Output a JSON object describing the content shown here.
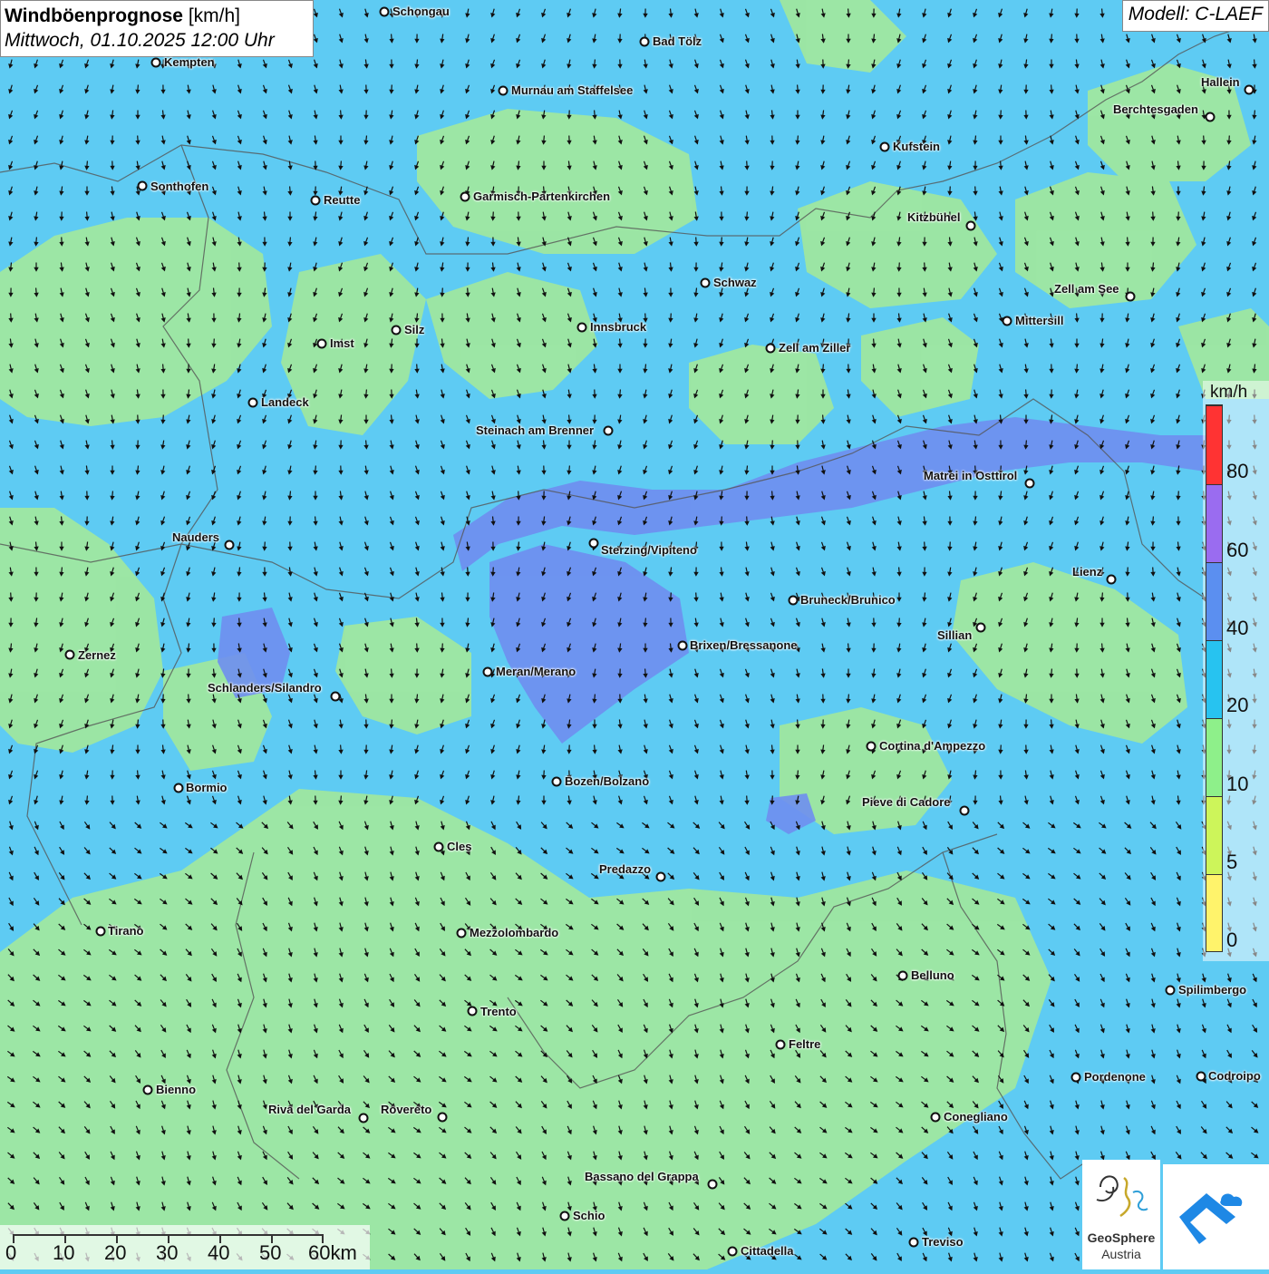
{
  "title": {
    "main": "Windböenprognose",
    "unit": "[km/h]",
    "datetime": "Mittwoch, 01.10.2025 12:00 Uhr"
  },
  "model": "Modell: C-LAEF",
  "legend": {
    "unit": "km/h",
    "labels": [
      "80",
      "60",
      "40",
      "20",
      "10",
      "5",
      "0"
    ],
    "colors": [
      "#ff3333",
      "#9a6cf0",
      "#5b8ff0",
      "#27c3f0",
      "#8ef08a",
      "#cdf55a",
      "#fff36b"
    ]
  },
  "cities": [
    {
      "name": "Schongau",
      "id": "schongau"
    },
    {
      "name": "Bad Tölz",
      "id": "bad-toelz"
    },
    {
      "name": "Kempten",
      "id": "kempten"
    },
    {
      "name": "Murnau am Staffelsee",
      "id": "murnau"
    },
    {
      "name": "Hallein",
      "id": "hallein"
    },
    {
      "name": "Berchtesgaden",
      "id": "berchtesgaden"
    },
    {
      "name": "Kufstein",
      "id": "kufstein"
    },
    {
      "name": "Sonthofen",
      "id": "sonthofen"
    },
    {
      "name": "Reutte",
      "id": "reutte"
    },
    {
      "name": "Garmisch-Partenkirchen",
      "id": "garmisch"
    },
    {
      "name": "Kitzbühel",
      "id": "kitzbuehel"
    },
    {
      "name": "Schwaz",
      "id": "schwaz"
    },
    {
      "name": "Zell am See",
      "id": "zell-am-see"
    },
    {
      "name": "Mittersill",
      "id": "mittersill"
    },
    {
      "name": "Innsbruck",
      "id": "innsbruck"
    },
    {
      "name": "Silz",
      "id": "silz"
    },
    {
      "name": "Imst",
      "id": "imst"
    },
    {
      "name": "Zell am Ziller",
      "id": "zell-am-ziller"
    },
    {
      "name": "Landeck",
      "id": "landeck"
    },
    {
      "name": "Steinach am Brenner",
      "id": "steinach"
    },
    {
      "name": "Matrei in Osttirol",
      "id": "matrei"
    },
    {
      "name": "Nauders",
      "id": "nauders"
    },
    {
      "name": "Sterzing/Vipiteno",
      "id": "sterzing"
    },
    {
      "name": "Lienz",
      "id": "lienz"
    },
    {
      "name": "Bruneck/Brunico",
      "id": "bruneck"
    },
    {
      "name": "Sillian",
      "id": "sillian"
    },
    {
      "name": "Brixen/Bressanone",
      "id": "brixen"
    },
    {
      "name": "Zernez",
      "id": "zernez"
    },
    {
      "name": "Meran/Merano",
      "id": "meran"
    },
    {
      "name": "Schlanders/Silandro",
      "id": "schlanders"
    },
    {
      "name": "Cortina d'Ampezzo",
      "id": "cortina"
    },
    {
      "name": "Bozen/Bolzano",
      "id": "bozen"
    },
    {
      "name": "Bormio",
      "id": "bormio"
    },
    {
      "name": "Pieve di Cadore",
      "id": "pieve"
    },
    {
      "name": "Cles",
      "id": "cles"
    },
    {
      "name": "Predazzo",
      "id": "predazzo"
    },
    {
      "name": "Tirano",
      "id": "tirano"
    },
    {
      "name": "Mezzolombardo",
      "id": "mezzolombardo"
    },
    {
      "name": "Belluno",
      "id": "belluno"
    },
    {
      "name": "Spilimbergo",
      "id": "spilimbergo"
    },
    {
      "name": "Trento",
      "id": "trento"
    },
    {
      "name": "Feltre",
      "id": "feltre"
    },
    {
      "name": "Pordenone",
      "id": "pordenone"
    },
    {
      "name": "Codroipo",
      "id": "codroipo"
    },
    {
      "name": "Bienno",
      "id": "bienno"
    },
    {
      "name": "Riva del Garda",
      "id": "riva"
    },
    {
      "name": "Rovereto",
      "id": "rovereto"
    },
    {
      "name": "Conegliano",
      "id": "conegliano"
    },
    {
      "name": "Bassano del Grappa",
      "id": "bassano"
    },
    {
      "name": "Schio",
      "id": "schio"
    },
    {
      "name": "Treviso",
      "id": "treviso"
    },
    {
      "name": "Cittadella",
      "id": "cittadella"
    }
  ],
  "scale": {
    "labels": [
      "0",
      "10",
      "20",
      "30",
      "40",
      "50",
      "60km"
    ]
  },
  "logo": {
    "line1": "GeoSphere",
    "line2": "Austria"
  }
}
